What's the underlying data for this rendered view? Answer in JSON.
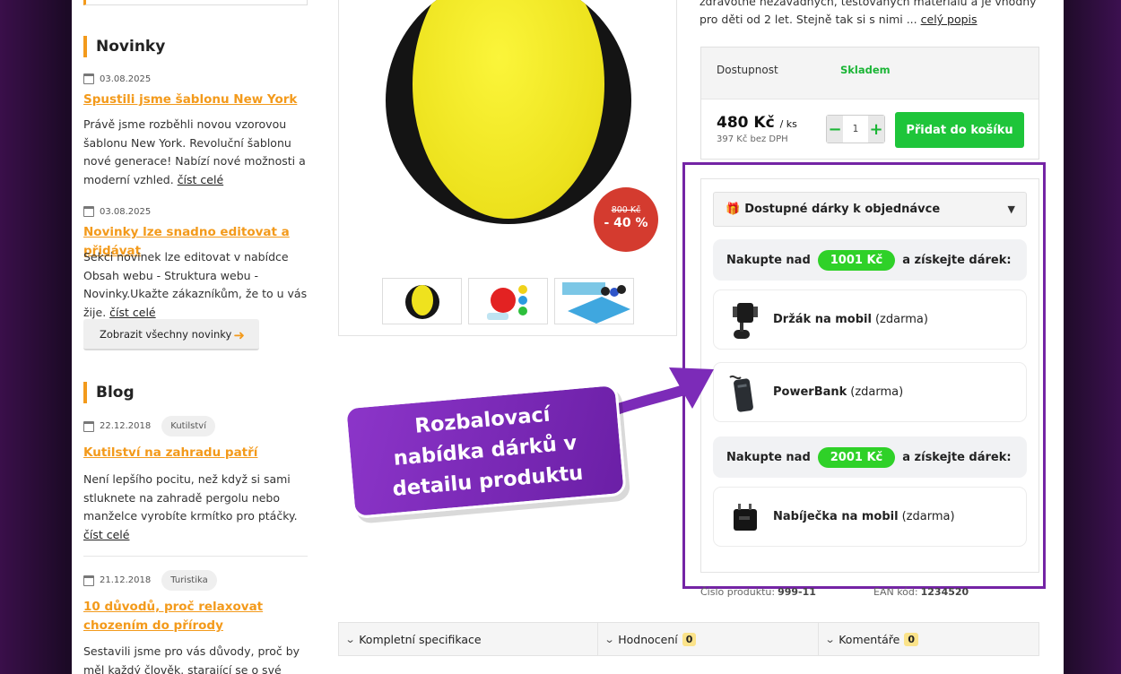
{
  "sidebar": {
    "news_title": "Novinky",
    "news": [
      {
        "date": "03.08.2025",
        "title": "Spustili jsme šablonu New York",
        "text": "Právě jsme rozběhli novou vzorovou šablonu New York. Revoluční šablonu nové generace! Nabízí nové možnosti a moderní vzhled.",
        "read_more": "číst celé"
      },
      {
        "date": "03.08.2025",
        "title": "Novinky lze snadno editovat a přidávat",
        "text": "Sekci novinek lze editovat v nabídce Obsah webu - Struktura webu - Novinky.Ukažte zákazníkům, že to u vás žije.",
        "read_more": "číst celé"
      }
    ],
    "all_news_button": "Zobrazit všechny novinky",
    "blog_title": "Blog",
    "blog": [
      {
        "date": "22.12.2018",
        "tag": "Kutilství",
        "title": "Kutilství na zahradu patří",
        "text": "Není lepšího pocitu, než když si sami stluknete na zahradě pergolu nebo manželce vyrobíte krmítko pro ptáčky.",
        "read_more": "číst celé"
      },
      {
        "date": "21.12.2018",
        "tag": "Turistika",
        "title": "10 důvodů, proč relaxovat chozením do přírody",
        "text": "Sestavili jsme pro vás důvody, proč by měl každý člověk, starající se o své zdraví,"
      }
    ]
  },
  "product": {
    "old_price": "800 Kč",
    "discount": "- 40 %",
    "description": "zdravotně nezávadných, testovaných materiálů a je vhodný pro děti od 2 let. Stejně tak si s nimi ...",
    "description_link": "celý popis",
    "availability_label": "Dostupnost",
    "availability_value": "Skladem",
    "price": "480 Kč",
    "price_unit": "/ ks",
    "price_net": "397 Kč bez DPH",
    "qty": "1",
    "qty_minus": "−",
    "qty_plus": "+",
    "add_to_cart": "Přidat do košíku",
    "product_code_label": "Číslo produktu:",
    "product_code": "999-11",
    "ean_label": "EAN kód:",
    "ean": "1234520"
  },
  "gifts": {
    "header": "Dostupné dárky k objednávce",
    "header_icon": "gift-icon",
    "groups": [
      {
        "prefix": "Nakupte nad",
        "amount": "1001 Kč",
        "suffix": "a získejte dárek:",
        "items": [
          {
            "name": "Držák na mobil",
            "note": "(zdarma)",
            "icon": "phone-holder-icon"
          },
          {
            "name": "PowerBank",
            "note": "(zdarma)",
            "icon": "powerbank-icon"
          }
        ]
      },
      {
        "prefix": "Nakupte nad",
        "amount": "2001 Kč",
        "suffix": "a získejte dárek:",
        "items": [
          {
            "name": "Nabíječka na mobil",
            "note": "(zdarma)",
            "icon": "charger-icon"
          }
        ]
      }
    ]
  },
  "tabs": [
    {
      "label": "Kompletní specifikace"
    },
    {
      "label": "Hodnocení",
      "count": "0"
    },
    {
      "label": "Komentáře",
      "count": "0"
    }
  ],
  "callout": "Rozbalovací nabídka dárků v detailu produktu",
  "colors": {
    "accent": "#f39a1b",
    "green": "#1ec53a",
    "highlight": "#7424a5",
    "sale": "#d43b2f"
  }
}
